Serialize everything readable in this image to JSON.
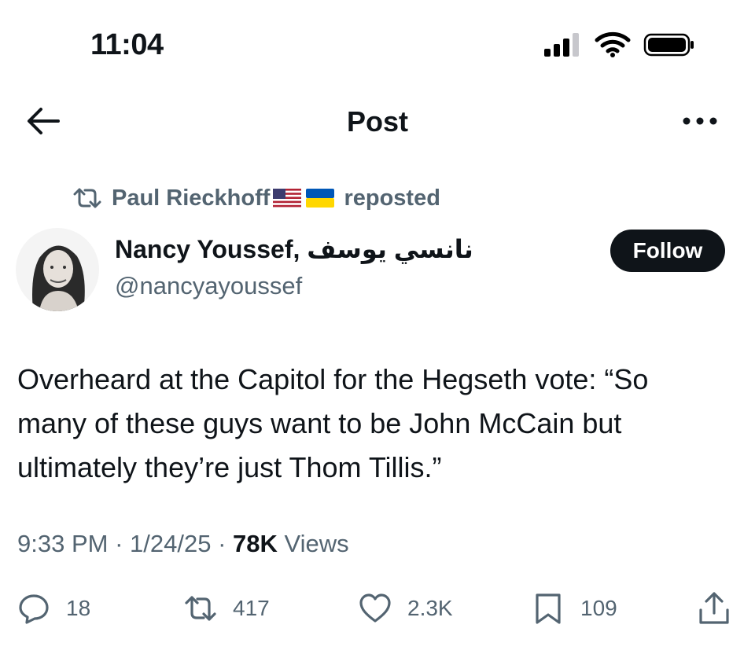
{
  "status_bar": {
    "time": "11:04"
  },
  "header": {
    "title": "Post"
  },
  "repost": {
    "name": "Paul Rieckhoff",
    "suffix": "reposted"
  },
  "author": {
    "display_name": "Nancy Youssef, نانسي يوسف",
    "handle": "@nancyayoussef",
    "follow_label": "Follow"
  },
  "tweet": {
    "line1": "Overheard at the Capitol for the Hegseth vote: “So",
    "line2": "many of these guys want to be John McCain but",
    "line3": "ultimately they’re just Thom Tillis.”"
  },
  "meta": {
    "time": "9:33 PM",
    "date": "1/24/25",
    "views_count": "78K",
    "views_label": "Views"
  },
  "actions": {
    "replies": "18",
    "reposts": "417",
    "likes": "2.3K",
    "bookmarks": "109"
  },
  "icons": [
    "back-arrow-icon",
    "more-icon",
    "repost-icon",
    "us-flag-icon",
    "ukraine-flag-icon",
    "reply-icon",
    "like-icon",
    "bookmark-icon",
    "share-icon",
    "signal-icon",
    "wifi-icon",
    "battery-icon"
  ],
  "colors": {
    "text": "#0f1419",
    "secondary": "#536471",
    "follow_bg": "#0f1419"
  }
}
